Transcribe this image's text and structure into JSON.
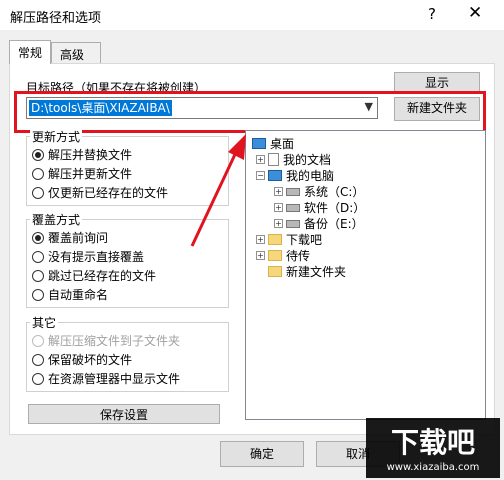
{
  "window": {
    "title": "解压路径和选项",
    "help": "?",
    "close": "✕"
  },
  "tabs": [
    "常规",
    "高级"
  ],
  "target": {
    "label": "目标路径（如果不存在将被创建）",
    "value": "D:\\tools\\桌面\\XIAZAIBA\\",
    "show_button": "显示",
    "new_folder_button": "新建文件夹"
  },
  "update_mode": {
    "title": "更新方式",
    "options": [
      "解压并替换文件",
      "解压并更新文件",
      "仅更新已经存在的文件"
    ],
    "selected": 0
  },
  "overwrite_mode": {
    "title": "覆盖方式",
    "options": [
      "覆盖前询问",
      "没有提示直接覆盖",
      "跳过已经存在的文件",
      "自动重命名"
    ],
    "selected": 0
  },
  "other": {
    "title": "其它",
    "options": [
      "解压压缩文件到子文件夹",
      "保留破坏的文件",
      "在资源管理器中显示文件"
    ]
  },
  "save_button": "保存设置",
  "tree": {
    "items": [
      "桌面",
      "我的文档",
      "我的电脑",
      "系统（C:）",
      "软件（D:）",
      "备份（E:）",
      "下载吧",
      "待传",
      "新建文件夹"
    ]
  },
  "footer": {
    "ok": "确定",
    "cancel": "取消"
  },
  "watermark": {
    "text": "下载吧",
    "url": "www.xiazaiba.com"
  },
  "colors": {
    "highlight": "#0078d7",
    "annotation": "#e0131f"
  }
}
